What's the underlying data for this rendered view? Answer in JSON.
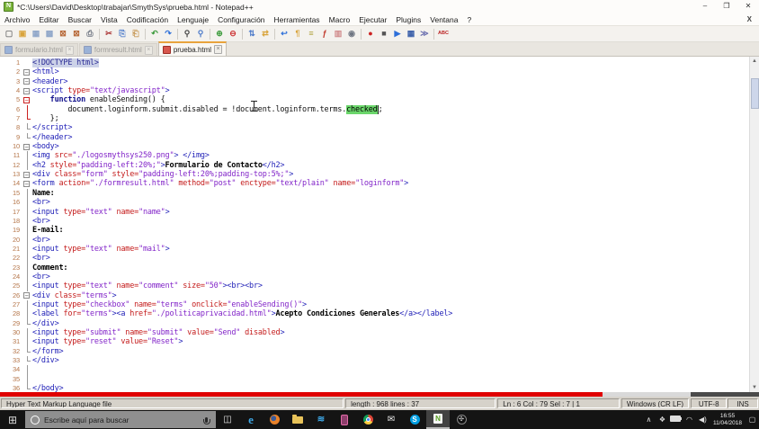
{
  "window": {
    "title": "*C:\\Users\\David\\Desktop\\trabajar\\SmythSys\\prueba.html - Notepad++",
    "app_icon_letter": "N",
    "controls": {
      "minimize": "–",
      "restore": "❐",
      "close": "✕"
    }
  },
  "menu": {
    "items": [
      "Archivo",
      "Editar",
      "Buscar",
      "Vista",
      "Codificación",
      "Lenguaje",
      "Configuración",
      "Herramientas",
      "Macro",
      "Ejecutar",
      "Plugins",
      "Ventana",
      "?"
    ],
    "close_label": "X"
  },
  "toolbar": {
    "groups": [
      [
        {
          "name": "new-file-icon",
          "g": "▢",
          "c": "#7a7a7a"
        },
        {
          "name": "open-folder-icon",
          "g": "▣",
          "c": "#d9a43c"
        },
        {
          "name": "save-icon",
          "g": "▦",
          "c": "#8fa6c9"
        },
        {
          "name": "save-all-icon",
          "g": "▩",
          "c": "#8fa6c9"
        },
        {
          "name": "close-doc-icon",
          "g": "⊠",
          "c": "#b86a3a"
        },
        {
          "name": "close-all-icon",
          "g": "⊠",
          "c": "#b86a3a"
        },
        {
          "name": "print-icon",
          "g": "⎙",
          "c": "#6f7682"
        }
      ],
      [
        {
          "name": "cut-icon",
          "g": "✂",
          "c": "#a33"
        },
        {
          "name": "copy-icon",
          "g": "⎘",
          "c": "#4a79c9"
        },
        {
          "name": "paste-icon",
          "g": "⎗",
          "c": "#c89a5a"
        }
      ],
      [
        {
          "name": "undo-icon",
          "g": "↶",
          "c": "#3a9a3a"
        },
        {
          "name": "redo-icon",
          "g": "↷",
          "c": "#2d6fd9"
        }
      ],
      [
        {
          "name": "find-icon",
          "g": "⚲",
          "c": "#444"
        },
        {
          "name": "replace-icon",
          "g": "⚲",
          "c": "#4a79c9"
        }
      ],
      [
        {
          "name": "zoom-in-icon",
          "g": "⊕",
          "c": "#3a9a3a"
        },
        {
          "name": "zoom-out-icon",
          "g": "⊖",
          "c": "#cc3333"
        }
      ],
      [
        {
          "name": "sync-vertical-icon",
          "g": "⇅",
          "c": "#4a79c9"
        },
        {
          "name": "sync-horizontal-icon",
          "g": "⇄",
          "c": "#d9a43c"
        }
      ],
      [
        {
          "name": "word-wrap-icon",
          "g": "↩",
          "c": "#2d6fd9"
        },
        {
          "name": "show-all-chars-icon",
          "g": "¶",
          "c": "#d9a43c"
        },
        {
          "name": "indent-guide-icon",
          "g": "≡",
          "c": "#b0a23c"
        },
        {
          "name": "function-list-icon",
          "g": "ƒ",
          "c": "#c0392b"
        },
        {
          "name": "doc-map-icon",
          "g": "▥",
          "c": "#d08a8a"
        },
        {
          "name": "doc-monitor-icon",
          "g": "◉",
          "c": "#6f7682"
        }
      ],
      [
        {
          "name": "record-macro-icon",
          "g": "●",
          "c": "#cc2222"
        },
        {
          "name": "stop-macro-icon",
          "g": "■",
          "c": "#555"
        },
        {
          "name": "play-macro-icon",
          "g": "▶",
          "c": "#2d6fd9"
        },
        {
          "name": "save-macro-icon",
          "g": "▦",
          "c": "#3a5fa9"
        },
        {
          "name": "run-macro-multi-icon",
          "g": "≫",
          "c": "#6a6faf"
        }
      ],
      [
        {
          "name": "spell-check-icon",
          "g": "ABC",
          "c": "#b22"
        }
      ]
    ]
  },
  "tabs": [
    {
      "label": "formulario.html",
      "active": false,
      "saved": true
    },
    {
      "label": "formresult.html",
      "active": false,
      "saved": true
    },
    {
      "label": "prueba.html",
      "active": true,
      "saved": false
    }
  ],
  "editor": {
    "lines": [
      {
        "f": "",
        "s": [
          [
            "doctype",
            "<!DOCTYPE html>"
          ]
        ]
      },
      {
        "f": "s",
        "s": [
          [
            "tag",
            "<html>"
          ]
        ]
      },
      {
        "f": "s",
        "s": [
          [
            "tag",
            "<header>"
          ]
        ]
      },
      {
        "f": "s",
        "s": [
          [
            "tag",
            "<script "
          ],
          [
            "attr",
            "type="
          ],
          [
            "val",
            "\"text/javascript\""
          ],
          [
            "tag",
            ">"
          ]
        ]
      },
      {
        "f": "r",
        "s": [
          [
            "plain",
            "    "
          ],
          [
            "kw",
            "function"
          ],
          [
            "plain",
            " enableSending() {"
          ]
        ]
      },
      {
        "f": "rl",
        "s": [
          [
            "plain",
            "        document.loginform.submit.disabled = !document.loginform.terms."
          ],
          [
            "sel",
            "checked"
          ],
          [
            "plain",
            ";"
          ]
        ]
      },
      {
        "f": "re",
        "s": [
          [
            "plain",
            "    };"
          ]
        ]
      },
      {
        "f": "e",
        "s": [
          [
            "tag",
            "</script>"
          ]
        ]
      },
      {
        "f": "e",
        "s": [
          [
            "tag",
            "</header>"
          ]
        ]
      },
      {
        "f": "s",
        "s": [
          [
            "tag",
            "<body>"
          ]
        ]
      },
      {
        "f": "l",
        "s": [
          [
            "tag",
            "<img "
          ],
          [
            "attr",
            "src="
          ],
          [
            "val",
            "\"./logosmythsys250.png\""
          ],
          [
            "tag",
            ">"
          ],
          [
            "plain",
            " "
          ],
          [
            "tag",
            "</img>"
          ]
        ]
      },
      {
        "f": "l",
        "s": [
          [
            "tag",
            "<h2 "
          ],
          [
            "attr",
            "style="
          ],
          [
            "val",
            "\"padding-left:20%;\""
          ],
          [
            "tag",
            ">"
          ],
          [
            "text",
            "Formulario de Contacto"
          ],
          [
            "tag",
            "</h2>"
          ]
        ]
      },
      {
        "f": "s",
        "s": [
          [
            "tag",
            "<div "
          ],
          [
            "attr",
            "class="
          ],
          [
            "val",
            "\"form\""
          ],
          [
            "plain",
            " "
          ],
          [
            "attr",
            "style="
          ],
          [
            "val",
            "\"padding-left:20%;padding-top:5%;\""
          ],
          [
            "tag",
            ">"
          ]
        ]
      },
      {
        "f": "s",
        "s": [
          [
            "tag",
            "<form "
          ],
          [
            "attr",
            "action="
          ],
          [
            "val",
            "\"./formresult.html\""
          ],
          [
            "plain",
            " "
          ],
          [
            "attr",
            "method="
          ],
          [
            "val",
            "\"post\""
          ],
          [
            "plain",
            " "
          ],
          [
            "attr",
            "enctype="
          ],
          [
            "val",
            "\"text/plain\""
          ],
          [
            "plain",
            " "
          ],
          [
            "attr",
            "name="
          ],
          [
            "val",
            "\"loginform\""
          ],
          [
            "tag",
            ">"
          ]
        ]
      },
      {
        "f": "l",
        "s": [
          [
            "text",
            "Name:"
          ]
        ]
      },
      {
        "f": "l",
        "s": [
          [
            "tag",
            "<br>"
          ]
        ]
      },
      {
        "f": "l",
        "s": [
          [
            "tag",
            "<input "
          ],
          [
            "attr",
            "type="
          ],
          [
            "val",
            "\"text\""
          ],
          [
            "plain",
            " "
          ],
          [
            "attr",
            "name="
          ],
          [
            "val",
            "\"name\""
          ],
          [
            "tag",
            ">"
          ]
        ]
      },
      {
        "f": "l",
        "s": [
          [
            "tag",
            "<br>"
          ]
        ]
      },
      {
        "f": "l",
        "s": [
          [
            "text",
            "E-mail:"
          ]
        ]
      },
      {
        "f": "l",
        "s": [
          [
            "tag",
            "<br>"
          ]
        ]
      },
      {
        "f": "l",
        "s": [
          [
            "tag",
            "<input "
          ],
          [
            "attr",
            "type="
          ],
          [
            "val",
            "\"text\""
          ],
          [
            "plain",
            " "
          ],
          [
            "attr",
            "name="
          ],
          [
            "val",
            "\"mail\""
          ],
          [
            "tag",
            ">"
          ]
        ]
      },
      {
        "f": "l",
        "s": [
          [
            "tag",
            "<br>"
          ]
        ]
      },
      {
        "f": "l",
        "s": [
          [
            "text",
            "Comment:"
          ]
        ]
      },
      {
        "f": "l",
        "s": [
          [
            "tag",
            "<br>"
          ]
        ]
      },
      {
        "f": "l",
        "s": [
          [
            "tag",
            "<input "
          ],
          [
            "attr",
            "type="
          ],
          [
            "val",
            "\"text\""
          ],
          [
            "plain",
            " "
          ],
          [
            "attr",
            "name="
          ],
          [
            "val",
            "\"comment\""
          ],
          [
            "plain",
            " "
          ],
          [
            "attr",
            "size="
          ],
          [
            "val",
            "\"50\""
          ],
          [
            "tag",
            "><br><br>"
          ]
        ]
      },
      {
        "f": "s",
        "s": [
          [
            "tag",
            "<div "
          ],
          [
            "attr",
            "class="
          ],
          [
            "val",
            "\"terms\""
          ],
          [
            "tag",
            ">"
          ]
        ]
      },
      {
        "f": "l",
        "s": [
          [
            "tag",
            "<input "
          ],
          [
            "attr",
            "type="
          ],
          [
            "val",
            "\"checkbox\""
          ],
          [
            "plain",
            " "
          ],
          [
            "attr",
            "name="
          ],
          [
            "val",
            "\"terms\""
          ],
          [
            "plain",
            " "
          ],
          [
            "attr",
            "onclick="
          ],
          [
            "val",
            "\"enableSending()\""
          ],
          [
            "tag",
            ">"
          ]
        ]
      },
      {
        "f": "l",
        "s": [
          [
            "tag",
            "<label "
          ],
          [
            "attr",
            "for="
          ],
          [
            "val",
            "\"terms\""
          ],
          [
            "tag",
            "><a "
          ],
          [
            "attr",
            "href="
          ],
          [
            "val",
            "\"./politicaprivacidad.html\""
          ],
          [
            "tag",
            ">"
          ],
          [
            "text",
            "Acepto Condiciones Generales"
          ],
          [
            "tag",
            "</a></label>"
          ]
        ]
      },
      {
        "f": "e",
        "s": [
          [
            "tag",
            "</div>"
          ]
        ]
      },
      {
        "f": "l",
        "s": [
          [
            "tag",
            "<input "
          ],
          [
            "attr",
            "type="
          ],
          [
            "val",
            "\"submit\""
          ],
          [
            "plain",
            " "
          ],
          [
            "attr",
            "name="
          ],
          [
            "val",
            "\"submit\""
          ],
          [
            "plain",
            " "
          ],
          [
            "attr",
            "value="
          ],
          [
            "val",
            "\"Send\""
          ],
          [
            "plain",
            " "
          ],
          [
            "attr",
            "disabled"
          ],
          [
            "tag",
            ">"
          ]
        ]
      },
      {
        "f": "l",
        "s": [
          [
            "tag",
            "<input "
          ],
          [
            "attr",
            "type="
          ],
          [
            "val",
            "\"reset\""
          ],
          [
            "plain",
            " "
          ],
          [
            "attr",
            "value="
          ],
          [
            "val",
            "\"Reset\""
          ],
          [
            "tag",
            ">"
          ]
        ]
      },
      {
        "f": "e",
        "s": [
          [
            "tag",
            "</form>"
          ]
        ]
      },
      {
        "f": "e",
        "s": [
          [
            "tag",
            "</div>"
          ]
        ]
      },
      {
        "f": "l",
        "s": []
      },
      {
        "f": "l",
        "s": []
      },
      {
        "f": "e",
        "s": [
          [
            "tag",
            "</body>"
          ]
        ]
      }
    ]
  },
  "status": {
    "doc_type": "Hyper Text Markup Language file",
    "length_info": "length : 968    lines : 37",
    "position_info": "Ln : 6    Col : 79    Sel : 7 | 1",
    "eol": "Windows (CR LF)",
    "encoding": "UTF-8",
    "mode": "INS"
  },
  "video_progress": {
    "played_color": "#e00000",
    "played_fraction": "79.4%"
  },
  "taskbar": {
    "search_placeholder": "Escribe aquí para buscar",
    "clock_time": "16:55",
    "clock_date": "11/04/2018",
    "tray_caret": "∧"
  }
}
